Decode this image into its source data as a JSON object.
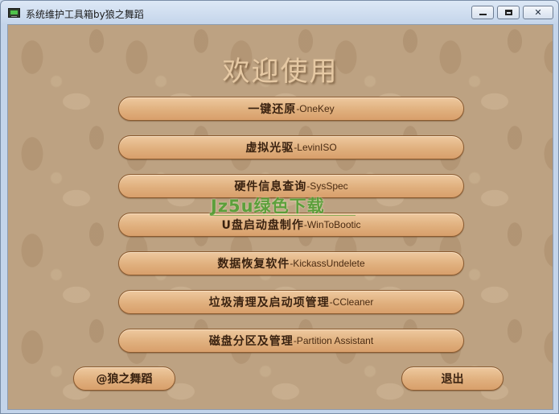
{
  "window": {
    "title": "系统维护工具箱by狼之舞蹈",
    "icon": "terminal-app-icon",
    "controls": [
      "minimize",
      "maximize",
      "close"
    ]
  },
  "heading": "欢迎使用",
  "menu": [
    {
      "zh": "一键还原",
      "en": "-OneKey"
    },
    {
      "zh": "虚拟光驱",
      "en": "-LevinISO"
    },
    {
      "zh": "硬件信息查询",
      "en": "-SysSpec"
    },
    {
      "zh": "U盘启动盘制作",
      "en": "-WinToBootic"
    },
    {
      "zh": "数据恢复软件",
      "en": "-KickassUndelete"
    },
    {
      "zh": "垃圾清理及启动项管理",
      "en": "-CCleaner"
    },
    {
      "zh": "磁盘分区及管理",
      "en": "-Partition Assistant"
    }
  ],
  "footer": {
    "author_label": "@狼之舞蹈",
    "exit_label": "退出"
  },
  "watermark": "Jz5u绿色下载",
  "colors": {
    "button_fill": "#e0b07e",
    "button_border": "#8a5a2f",
    "background": "#bda282",
    "heading": "#e6c9a4",
    "watermark": "#4c9f2f"
  }
}
